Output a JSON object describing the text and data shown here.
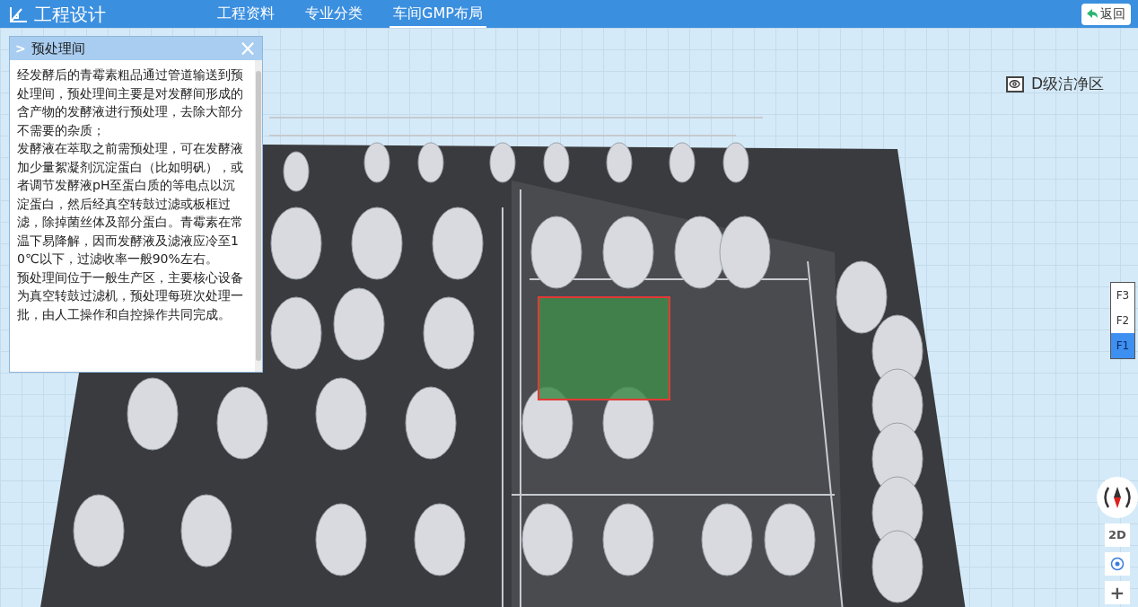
{
  "header": {
    "title": "工程设计",
    "nav": [
      {
        "label": "工程资料",
        "selected": false
      },
      {
        "label": "专业分类",
        "selected": false
      },
      {
        "label": "车间GMP布局",
        "selected": true
      }
    ],
    "back_button": "返回"
  },
  "info_panel": {
    "marker": ">",
    "title": "预处理间",
    "close": "×",
    "paragraphs": [
      "经发酵后的青霉素粗品通过管道输送到预处理间，预处理间主要是对发酵间形成的含产物的发酵液进行预处理，去除大部分不需要的杂质；",
      "发酵液在萃取之前需预处理，可在发酵液加少量絮凝剂沉淀蛋白（比如明矾），或者调节发酵液pH至蛋白质的等电点以沉淀蛋白，然后经真空转鼓过滤或板框过滤，除掉菌丝体及部分蛋白。青霉素在常温下易降解，因而发酵液及滤液应冷至10℃以下，过滤收率一般90%左右。",
      "预处理间位于一般生产区，主要核心设备为真空转鼓过滤机，预处理每班次处理一批，由人工操作和自控操作共同完成。"
    ]
  },
  "zone_toggle": {
    "label": "D级洁净区",
    "visible": true
  },
  "floors": [
    {
      "label": "F3",
      "selected": false
    },
    {
      "label": "F2",
      "selected": false
    },
    {
      "label": "F1",
      "selected": true
    }
  ],
  "view_controls": {
    "mode_button": "2D",
    "zoom_in": "+"
  }
}
